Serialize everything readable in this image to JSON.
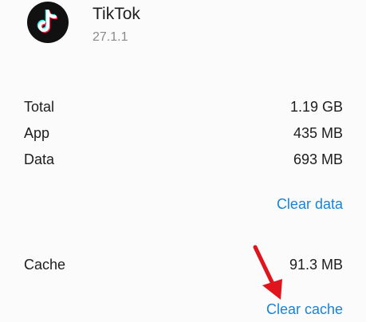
{
  "app": {
    "name": "TikTok",
    "version": "27.1.1",
    "icon": "tiktok-logo-icon"
  },
  "storage": {
    "rows": [
      {
        "label": "Total",
        "value": "1.19 GB"
      },
      {
        "label": "App",
        "value": "435 MB"
      },
      {
        "label": "Data",
        "value": "693 MB"
      }
    ],
    "clear_data_label": "Clear data",
    "cache": {
      "label": "Cache",
      "value": "91.3 MB"
    },
    "clear_cache_label": "Clear cache"
  },
  "colors": {
    "link": "#1a83d6",
    "annotation_arrow": "#e0141c",
    "icon_bg": "#111111"
  }
}
